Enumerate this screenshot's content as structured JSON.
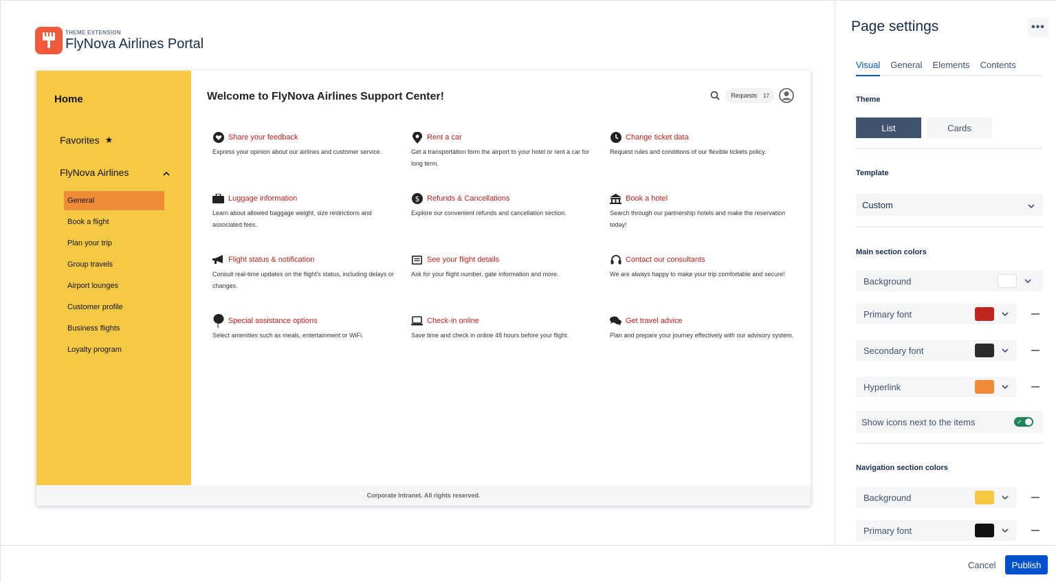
{
  "header": {
    "extension_label": "THEME EXTENSION",
    "portal_title": "FlyNova Airlines Portal",
    "logo_icon": "paintbrush-icon"
  },
  "preview": {
    "nav": {
      "home": "Home",
      "favorites": "Favorites",
      "group": "FlyNova Airlines",
      "items": [
        {
          "label": "General",
          "active": true
        },
        {
          "label": "Book a flight"
        },
        {
          "label": "Plan your trip"
        },
        {
          "label": "Group travels"
        },
        {
          "label": "Airport lounges"
        },
        {
          "label": "Customer profile"
        },
        {
          "label": "Business flights"
        },
        {
          "label": "Loyalty program"
        }
      ],
      "background": "#f6c944",
      "active_color": "#f08c37"
    },
    "welcome": "Welcome to FlyNova Airlines Support Center!",
    "requests_label": "Requests",
    "requests_count": "17",
    "items": [
      {
        "icon": "heart-icon",
        "title": "Share your feedback",
        "desc": "Express your opinion about our airlines and customer service."
      },
      {
        "icon": "map-pin-icon",
        "title": "Rent a car",
        "desc": "Get a transportation form the airport to your hotel or rent a car for long term."
      },
      {
        "icon": "clock-icon",
        "title": "Change ticket data",
        "desc": "Request rules and conditions of our flexible tickets policy."
      },
      {
        "icon": "briefcase-icon",
        "title": "Luggage information",
        "desc": "Learn about allowed baggage weight, size restrictions and associated fees."
      },
      {
        "icon": "dollar-icon",
        "title": "Refunds & Cancellations",
        "desc": "Explore our convenient refunds and cancellation section."
      },
      {
        "icon": "hotel-icon",
        "title": "Book a hotel",
        "desc": "Search through our partnership hotels and make the reservation today!"
      },
      {
        "icon": "megaphone-icon",
        "title": "Flight status & notification",
        "desc": "Consult real-time updates on the flight's status, including delays or changes."
      },
      {
        "icon": "document-icon",
        "title": "See your flight details",
        "desc": "Ask for your flight number, gate information and more."
      },
      {
        "icon": "headset-icon",
        "title": "Contact our consultants",
        "desc": "We are always happy to make your trip comfortable and secure!"
      },
      {
        "icon": "balloon-icon",
        "title": "Special assistance options",
        "desc": "Select amenities such as meals, entertainment or WiFi."
      },
      {
        "icon": "laptop-icon",
        "title": "Check-in online",
        "desc": "Save time and check in online 48 hours before your flight."
      },
      {
        "icon": "chat-icon",
        "title": "Get travel advice",
        "desc": "Plan and prepare your journey effectively with our advisory system."
      }
    ],
    "footer": "Corporate Intranet. All rights reserved.",
    "link_color": "#c0211b"
  },
  "panel": {
    "title": "Page settings",
    "tabs": [
      {
        "label": "Visual",
        "active": true
      },
      {
        "label": "General"
      },
      {
        "label": "Elements"
      },
      {
        "label": "Contents"
      }
    ],
    "theme_label": "Theme",
    "theme_options": {
      "list": "List",
      "cards": "Cards",
      "selected": "List"
    },
    "template_label": "Template",
    "template_value": "Custom",
    "main_colors_label": "Main section colors",
    "main_colors": [
      {
        "label": "Background",
        "color": "#ffffff"
      },
      {
        "label": "Primary font",
        "color": "#c0261f"
      },
      {
        "label": "Secondary font",
        "color": "#2b2b2b"
      },
      {
        "label": "Hyperlink",
        "color": "#f08a37"
      }
    ],
    "show_icons_label": "Show icons next to the items",
    "show_icons_enabled": true,
    "nav_colors_label": "Navigation section colors",
    "nav_colors": [
      {
        "label": "Background",
        "color": "#f6c944"
      },
      {
        "label": "Primary font",
        "color": "#111111"
      }
    ]
  },
  "actions": {
    "cancel": "Cancel",
    "publish": "Publish"
  }
}
